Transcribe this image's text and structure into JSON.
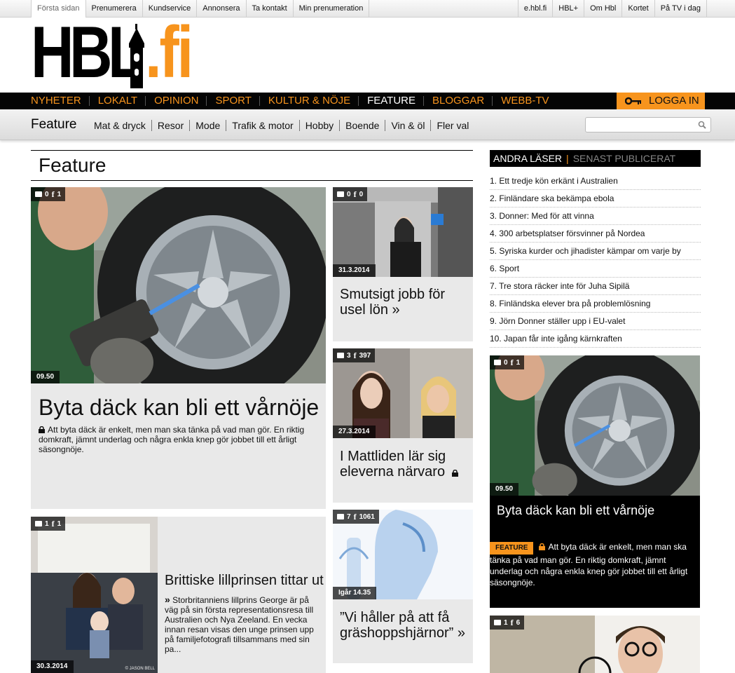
{
  "topbar": {
    "left": [
      "Första sidan",
      "Prenumerera",
      "Kundservice",
      "Annonsera",
      "Ta kontakt",
      "Min prenumeration"
    ],
    "right": [
      "e.hbl.fi",
      "HBL+",
      "Om Hbl",
      "Kortet",
      "På TV i dag"
    ]
  },
  "logo": {
    "main": "HBL",
    "suffix": ".fi"
  },
  "mainnav": {
    "items": [
      "NYHETER",
      "LOKALT",
      "OPINION",
      "SPORT",
      "KULTUR & NÖJE",
      "FEATURE",
      "BLOGGAR",
      "WEBB-TV"
    ],
    "login": "LOGGA IN"
  },
  "subnav": {
    "section": "Feature",
    "items": [
      "Mat & dryck",
      "Resor",
      "Mode",
      "Trafik & motor",
      "Hobby",
      "Boende",
      "Vin & öl",
      "Fler val"
    ]
  },
  "heading": "Feature",
  "articles": {
    "main": {
      "comments": "0",
      "fb": "1",
      "date": "09.50",
      "title": "Byta däck kan bli ett vårnöje",
      "text": "Att byta däck är enkelt, men man ska tänka på vad man gör. En riktig domkraft, jämnt underlag och några enkla knep gör jobbet till ett årligt säsongnöje."
    },
    "a2": {
      "comments": "0",
      "fb": "0",
      "date": "31.3.2014",
      "title": "Smutsigt jobb för usel lön »"
    },
    "a3": {
      "comments": "3",
      "fb": "397",
      "date": "27.3.2014",
      "title": "I Mattliden lär sig eleverna närvaro"
    },
    "a4": {
      "comments": "1",
      "fb": "1",
      "date": "30.3.2014",
      "credit": "© JASON BELL",
      "title": "Brittiske lillprinsen tittar ut",
      "text": "Storbritanniens lillprins George är på väg på sin första representationsresa till Australien och Nya Zeeland. En vecka innan resan visas den unge prinsen upp på familjefotografi tillsammans med sin pa..."
    },
    "a5": {
      "comments": "7",
      "fb": "1061",
      "date": "Igår 14.35",
      "title": "”Vi håller på att få gräshoppshjärnor” »"
    }
  },
  "sidebar": {
    "tab_active": "ANDRA LÄSER",
    "tab_inactive": "SENAST PUBLICERAT",
    "list": [
      "1. Ett tredje kön erkänt i Australien",
      "2. Finländare ska bekämpa ebola",
      "3. Donner: Med för att vinna",
      "4. 300 arbetsplatser försvinner på Nordea",
      "5. Syriska kurder och jihadister kämpar om varje by",
      "6. Sport",
      "7. Tre stora räcker inte för Juha Sipilä",
      "8. Finländska elever bra på problemlösning",
      "9. Jörn Donner ställer upp i EU-valet",
      "10. Japan får inte igång kärnkraften"
    ],
    "card1": {
      "comments": "0",
      "fb": "1",
      "date": "09.50",
      "title": "Byta däck kan bli ett vårnöje",
      "tag": "FEATURE",
      "text": "Att byta däck är enkelt, men man ska tänka på vad man gör. En riktig domkraft, jämnt underlag och några enkla knep gör jobbet till ett årligt säsongnöje."
    },
    "card2": {
      "comments": "1",
      "fb": "6"
    }
  },
  "colors": {
    "accent": "#f7941d",
    "nav_bg": "#050505",
    "card_bg": "#e9e9e9"
  }
}
